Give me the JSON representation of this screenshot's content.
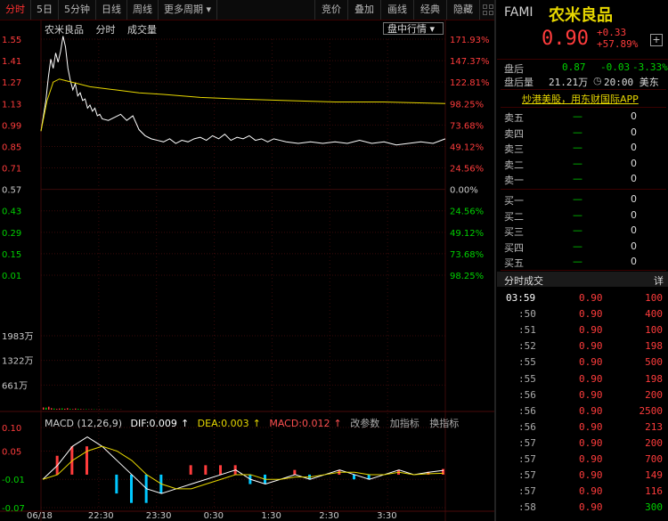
{
  "toolbar": {
    "tabs": [
      "分时",
      "5日",
      "5分钟",
      "日线",
      "周线",
      "更多周期"
    ],
    "active_tab": "分时",
    "right_tabs": [
      "竞价",
      "叠加",
      "画线",
      "经典",
      "隐藏"
    ],
    "more_periods_arrow": "▾",
    "grid_icon": "grid-icon"
  },
  "chart_header": {
    "stock_name": "农米良品",
    "tab_timeshare": "分时",
    "tab_volume": "成交量",
    "dropdown": "盘中行情",
    "dropdown_arrow": "▾"
  },
  "macd_header": {
    "name": "MACD (12,26,9)",
    "dif": "DIF:0.009",
    "dea": "DEA:0.003",
    "macd": "MACD:0.012",
    "modify_param": "改参数",
    "add_indicator": "加指标",
    "switch_indicator": "换指标"
  },
  "colors": {
    "up": "#ff3c3c",
    "down": "#00d000",
    "price_line": "#ffffff",
    "avg_line": "#e8d800",
    "dif_line": "#ffffff",
    "dea_line": "#e8d800",
    "grid": "#3a0a0a"
  },
  "chart_data": {
    "type": "line",
    "title": "",
    "price_axis_left": [
      "1.55",
      "1.41",
      "1.27",
      "1.13",
      "0.99",
      "0.85",
      "0.71",
      "0.57",
      "0.43",
      "0.29",
      "0.15",
      "0.01"
    ],
    "percent_axis_right": [
      "171.93%",
      "147.37%",
      "122.81%",
      "98.25%",
      "73.68%",
      "49.12%",
      "24.56%",
      "0.00%",
      "24.56%",
      "49.12%",
      "73.68%",
      "98.25%"
    ],
    "pre_close": 0.57,
    "ylim": [
      0.01,
      1.55
    ],
    "volume_axis": [
      "1983万",
      "1322万",
      "661万"
    ],
    "volume_ylim": [
      0,
      1983
    ],
    "macd_axis": [
      "0.10",
      "0.05",
      "-0.01",
      "-0.07"
    ],
    "macd_ylim": [
      -0.07,
      0.1
    ],
    "x_ticks": [
      "06/18",
      "22:30",
      "23:30",
      "0:30",
      "1:30",
      "2:30",
      "3:30"
    ],
    "series": [
      {
        "x": [
          0,
          2,
          4,
          6,
          8,
          10,
          12,
          14,
          16,
          18,
          20,
          22,
          24,
          26,
          28,
          30,
          32,
          34,
          36,
          38,
          40,
          42,
          44,
          46,
          48,
          50,
          55,
          60,
          65,
          70,
          75,
          80,
          85,
          90,
          95,
          100,
          105,
          110,
          115,
          120,
          125,
          130,
          135,
          140,
          145,
          150,
          155,
          160,
          165,
          170,
          175,
          180,
          185,
          190,
          195,
          200,
          210,
          220,
          230,
          240,
          250,
          260,
          270,
          280,
          290,
          300,
          310,
          320,
          330
        ],
        "values": [
          0.95,
          1.05,
          1.15,
          1.3,
          1.42,
          1.36,
          1.46,
          1.4,
          1.47,
          1.57,
          1.5,
          1.36,
          1.28,
          1.22,
          1.26,
          1.18,
          1.2,
          1.15,
          1.16,
          1.1,
          1.12,
          1.08,
          1.1,
          1.05,
          1.06,
          1.03,
          1.02,
          1.04,
          1.06,
          1.02,
          1.05,
          0.96,
          0.92,
          0.9,
          0.89,
          0.88,
          0.9,
          0.87,
          0.89,
          0.88,
          0.9,
          0.91,
          0.89,
          0.92,
          0.9,
          0.93,
          0.89,
          0.91,
          0.9,
          0.92,
          0.89,
          0.9,
          0.88,
          0.9,
          0.89,
          0.88,
          0.87,
          0.88,
          0.87,
          0.88,
          0.87,
          0.89,
          0.87,
          0.88,
          0.86,
          0.87,
          0.88,
          0.87,
          0.9
        ]
      },
      {
        "x": [
          0,
          5,
          10,
          15,
          20,
          30,
          40,
          60,
          80,
          100,
          130,
          160,
          200,
          240,
          280,
          330
        ],
        "values": [
          0.95,
          1.15,
          1.27,
          1.29,
          1.28,
          1.26,
          1.24,
          1.22,
          1.2,
          1.19,
          1.17,
          1.16,
          1.15,
          1.14,
          1.14,
          1.13
        ]
      }
    ],
    "volume": [
      60,
      55,
      80,
      40,
      30,
      20,
      30,
      35,
      25,
      40,
      20,
      15,
      30,
      20,
      15,
      10,
      12,
      8,
      10,
      8,
      6,
      8,
      5,
      6,
      5,
      4,
      5,
      4,
      3,
      4
    ],
    "macd_dif": [
      -0.01,
      0.02,
      0.06,
      0.08,
      0.06,
      0.03,
      0.0,
      -0.03,
      -0.04,
      -0.03,
      -0.02,
      -0.01,
      0.0,
      0.01,
      -0.01,
      -0.02,
      -0.01,
      0.0,
      -0.01,
      0.0,
      0.01,
      0.0,
      -0.01,
      0.0,
      0.01,
      0.0,
      0.005,
      0.009
    ],
    "macd_dea": [
      -0.01,
      0.0,
      0.03,
      0.05,
      0.06,
      0.05,
      0.03,
      0.0,
      -0.02,
      -0.03,
      -0.03,
      -0.02,
      -0.01,
      0.0,
      0.0,
      -0.01,
      -0.01,
      -0.005,
      -0.005,
      0.0,
      0.005,
      0.005,
      0.0,
      0.0,
      0.005,
      0.0,
      0.002,
      0.003
    ],
    "macd_hist": [
      0.0,
      0.04,
      0.06,
      0.06,
      0.0,
      -0.04,
      -0.06,
      -0.06,
      -0.04,
      0.0,
      0.02,
      0.02,
      0.02,
      0.02,
      -0.02,
      -0.02,
      0.0,
      0.01,
      -0.01,
      0.0,
      0.01,
      -0.01,
      -0.01,
      0.0,
      0.01,
      0.0,
      0.006,
      0.012
    ]
  },
  "quote": {
    "code": "FAMI",
    "name": "农米良品",
    "price": "0.90",
    "change": "+0.33",
    "change_pct": "+57.89%",
    "plus_icon": "plus-icon",
    "after_hours_label": "盘后",
    "after_hours_price": "0.87",
    "after_hours_change": "-0.03",
    "after_hours_pct": "-3.33%",
    "after_vol_label": "盘后量",
    "after_vol": "21.21万",
    "after_time": "20:00 美东",
    "promo": "炒港美股，用东财国际APP"
  },
  "order_book": {
    "sell": [
      {
        "label": "卖五",
        "price": "—",
        "vol": "0"
      },
      {
        "label": "卖四",
        "price": "—",
        "vol": "0"
      },
      {
        "label": "卖三",
        "price": "—",
        "vol": "0"
      },
      {
        "label": "卖二",
        "price": "—",
        "vol": "0"
      },
      {
        "label": "卖一",
        "price": "—",
        "vol": "0"
      }
    ],
    "buy": [
      {
        "label": "买一",
        "price": "—",
        "vol": "0"
      },
      {
        "label": "买二",
        "price": "—",
        "vol": "0"
      },
      {
        "label": "买三",
        "price": "—",
        "vol": "0"
      },
      {
        "label": "买四",
        "price": "—",
        "vol": "0"
      },
      {
        "label": "买五",
        "price": "—",
        "vol": "0"
      }
    ]
  },
  "trades": {
    "title": "分时成交",
    "detail_button": "详",
    "rows": [
      {
        "time": "03:59",
        "price": "0.90",
        "vol": "100",
        "up": true
      },
      {
        "time": ":50",
        "price": "0.90",
        "vol": "400",
        "up": true
      },
      {
        "time": ":51",
        "price": "0.90",
        "vol": "100",
        "up": true
      },
      {
        "time": ":52",
        "price": "0.90",
        "vol": "198",
        "up": true
      },
      {
        "time": ":55",
        "price": "0.90",
        "vol": "500",
        "up": true
      },
      {
        "time": ":55",
        "price": "0.90",
        "vol": "198",
        "up": true
      },
      {
        "time": ":56",
        "price": "0.90",
        "vol": "200",
        "up": true
      },
      {
        "time": ":56",
        "price": "0.90",
        "vol": "2500",
        "up": true
      },
      {
        "time": ":56",
        "price": "0.90",
        "vol": "213",
        "up": true
      },
      {
        "time": ":57",
        "price": "0.90",
        "vol": "200",
        "up": true
      },
      {
        "time": ":57",
        "price": "0.90",
        "vol": "700",
        "up": true
      },
      {
        "time": ":57",
        "price": "0.90",
        "vol": "149",
        "up": true
      },
      {
        "time": ":57",
        "price": "0.90",
        "vol": "116",
        "up": true
      },
      {
        "time": ":58",
        "price": "0.90",
        "vol": "300",
        "up": false
      }
    ]
  }
}
